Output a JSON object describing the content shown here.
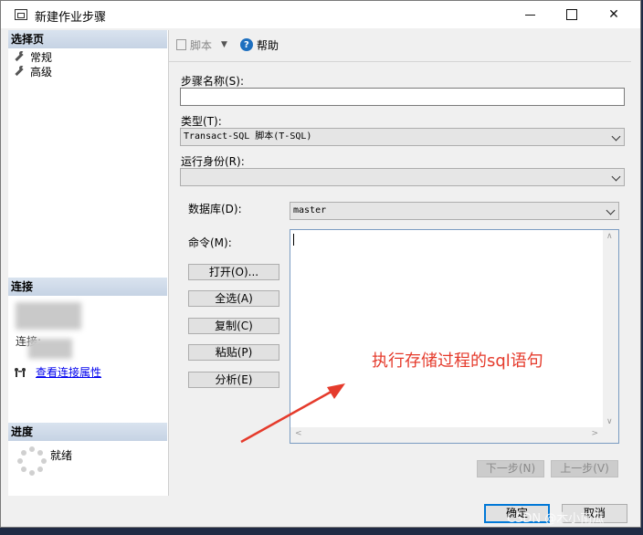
{
  "window": {
    "title": "新建作业步骤",
    "controls": {
      "minimize": "minimize-icon",
      "maximize": "maximize-icon",
      "close": "close-icon"
    }
  },
  "left": {
    "select_page": {
      "header": "选择页",
      "items": [
        {
          "label": "常规",
          "icon": "wrench-icon"
        },
        {
          "label": "高级",
          "icon": "wrench-icon"
        }
      ]
    },
    "connection": {
      "header": "连接",
      "partial_label": "连接:",
      "view_props_link": "查看连接属性"
    },
    "progress": {
      "header": "进度",
      "status": "就绪"
    }
  },
  "toolbar": {
    "script_label": "脚本",
    "help_label": "帮助"
  },
  "form": {
    "step_name": {
      "label": "步骤名称(S):",
      "hotkey": "S",
      "value": ""
    },
    "type": {
      "label": "类型(T):",
      "hotkey": "T",
      "value": "Transact-SQL 脚本(T-SQL)"
    },
    "run_as": {
      "label": "运行身份(R):",
      "hotkey": "R",
      "value": ""
    },
    "database": {
      "label": "数据库(D):",
      "hotkey": "D",
      "value": "master"
    },
    "command": {
      "label": "命令(M):",
      "hotkey": "M",
      "value": ""
    },
    "buttons": [
      "打开(O)...",
      "全选(A)",
      "复制(C)",
      "粘贴(P)",
      "分析(E)"
    ],
    "next_step": "下一步(N)",
    "prev_step": "上一步(V)"
  },
  "annotation": {
    "text": "执行存储过程的sql语句",
    "color": "#e53b2c"
  },
  "footer": {
    "ok": "确定",
    "cancel": "取消"
  },
  "watermark": "CSDN @木小南瓜"
}
